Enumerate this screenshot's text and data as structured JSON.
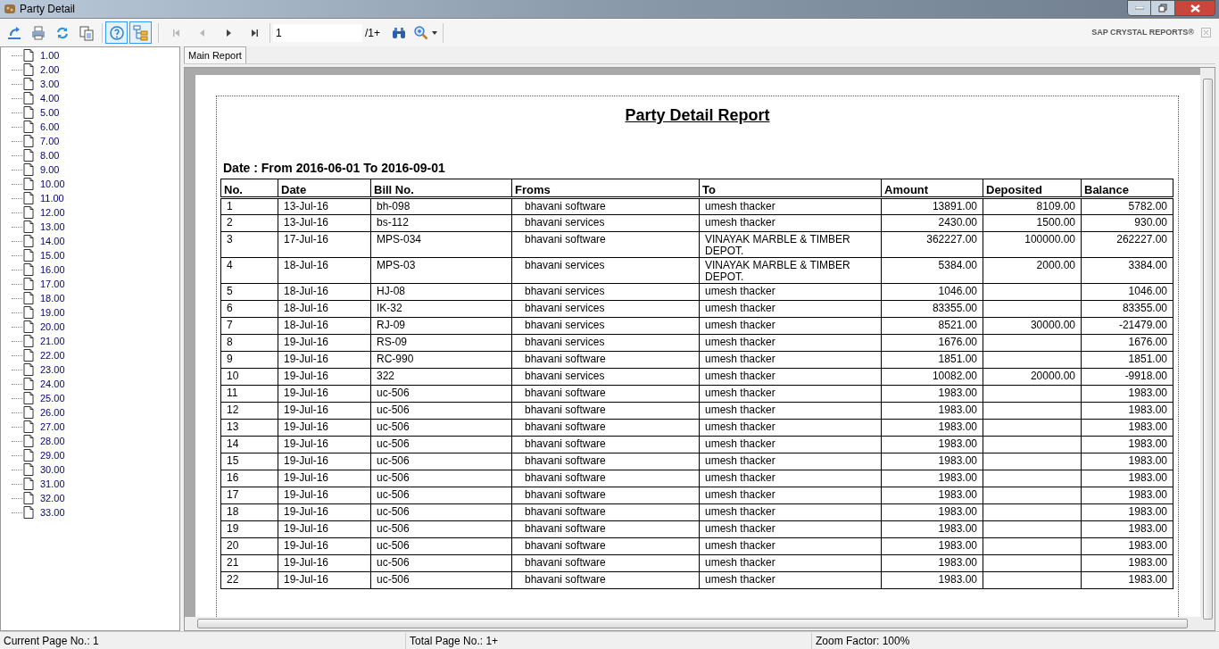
{
  "window": {
    "title": "Party Detail"
  },
  "toolbar": {
    "tools": [
      {
        "kind": "export",
        "selected": false
      },
      {
        "kind": "print",
        "selected": false
      },
      {
        "kind": "refresh",
        "selected": false
      },
      {
        "kind": "copy",
        "selected": false
      },
      {
        "kind": "help",
        "selected": true
      },
      {
        "kind": "tree",
        "selected": true
      }
    ],
    "nav": [
      {
        "kind": "first",
        "disabled": true
      },
      {
        "kind": "prev",
        "disabled": true
      },
      {
        "kind": "next",
        "disabled": false
      },
      {
        "kind": "last",
        "disabled": false
      }
    ],
    "page_field": "1",
    "page_total": "/1+",
    "brand": "SAP CRYSTAL REPORTS®"
  },
  "tree": {
    "items": [
      "1.00",
      "2.00",
      "3.00",
      "4.00",
      "5.00",
      "6.00",
      "7.00",
      "8.00",
      "9.00",
      "10.00",
      "11.00",
      "12.00",
      "13.00",
      "14.00",
      "15.00",
      "16.00",
      "17.00",
      "18.00",
      "19.00",
      "20.00",
      "21.00",
      "22.00",
      "23.00",
      "24.00",
      "25.00",
      "26.00",
      "27.00",
      "28.00",
      "29.00",
      "30.00",
      "31.00",
      "32.00",
      "33.00"
    ]
  },
  "tabs": [
    {
      "label": "Main Report",
      "selected": true
    }
  ],
  "report": {
    "title": "Party Detail Report",
    "date_range": "Date : From 2016-06-01 To 2016-09-01",
    "columns": [
      "No.",
      "Date",
      "Bill No.",
      "Froms",
      "To",
      "Amount",
      "Deposited",
      "Balance"
    ],
    "rows": [
      [
        "1",
        "13-Jul-16",
        "bh-098",
        "bhavani software",
        "umesh thacker",
        "13891.00",
        "8109.00",
        "5782.00"
      ],
      [
        "2",
        "13-Jul-16",
        "bs-112",
        "bhavani services",
        "umesh thacker",
        "2430.00",
        "1500.00",
        "930.00"
      ],
      [
        "3",
        "17-Jul-16",
        "MPS-034",
        "bhavani software",
        "VINAYAK MARBLE & TIMBER DEPOT.",
        "362227.00",
        "100000.00",
        "262227.00"
      ],
      [
        "4",
        "18-Jul-16",
        "MPS-03",
        "bhavani services",
        "VINAYAK MARBLE & TIMBER DEPOT.",
        "5384.00",
        "2000.00",
        "3384.00"
      ],
      [
        "5",
        "18-Jul-16",
        "HJ-08",
        "bhavani services",
        "umesh thacker",
        "1046.00",
        null,
        "1046.00"
      ],
      [
        "6",
        "18-Jul-16",
        "IK-32",
        "bhavani services",
        "umesh thacker",
        "83355.00",
        null,
        "83355.00"
      ],
      [
        "7",
        "18-Jul-16",
        "RJ-09",
        "bhavani services",
        "umesh thacker",
        "8521.00",
        "30000.00",
        "-21479.00"
      ],
      [
        "8",
        "19-Jul-16",
        "RS-09",
        "bhavani services",
        "umesh thacker",
        "1676.00",
        null,
        "1676.00"
      ],
      [
        "9",
        "19-Jul-16",
        "RC-990",
        "bhavani software",
        "umesh thacker",
        "1851.00",
        null,
        "1851.00"
      ],
      [
        "10",
        "19-Jul-16",
        "322",
        "bhavani services",
        "umesh thacker",
        "10082.00",
        "20000.00",
        "-9918.00"
      ],
      [
        "11",
        "19-Jul-16",
        "uc-506",
        "bhavani software",
        "umesh thacker",
        "1983.00",
        null,
        "1983.00"
      ],
      [
        "12",
        "19-Jul-16",
        "uc-506",
        "bhavani software",
        "umesh thacker",
        "1983.00",
        null,
        "1983.00"
      ],
      [
        "13",
        "19-Jul-16",
        "uc-506",
        "bhavani software",
        "umesh thacker",
        "1983.00",
        null,
        "1983.00"
      ],
      [
        "14",
        "19-Jul-16",
        "uc-506",
        "bhavani software",
        "umesh thacker",
        "1983.00",
        null,
        "1983.00"
      ],
      [
        "15",
        "19-Jul-16",
        "uc-506",
        "bhavani software",
        "umesh thacker",
        "1983.00",
        null,
        "1983.00"
      ],
      [
        "16",
        "19-Jul-16",
        "uc-506",
        "bhavani software",
        "umesh thacker",
        "1983.00",
        null,
        "1983.00"
      ],
      [
        "17",
        "19-Jul-16",
        "uc-506",
        "bhavani software",
        "umesh thacker",
        "1983.00",
        null,
        "1983.00"
      ],
      [
        "18",
        "19-Jul-16",
        "uc-506",
        "bhavani software",
        "umesh thacker",
        "1983.00",
        null,
        "1983.00"
      ],
      [
        "19",
        "19-Jul-16",
        "uc-506",
        "bhavani software",
        "umesh thacker",
        "1983.00",
        null,
        "1983.00"
      ],
      [
        "20",
        "19-Jul-16",
        "uc-506",
        "bhavani software",
        "umesh thacker",
        "1983.00",
        null,
        "1983.00"
      ],
      [
        "21",
        "19-Jul-16",
        "uc-506",
        "bhavani software",
        "umesh thacker",
        "1983.00",
        null,
        "1983.00"
      ],
      [
        "22",
        "19-Jul-16",
        "uc-506",
        "bhavani software",
        "umesh thacker",
        "1983.00",
        null,
        "1983.00"
      ]
    ]
  },
  "status_bar": [
    "Current Page No.: 1",
    "Total Page No.: 1+",
    "Zoom Factor: 100%"
  ]
}
